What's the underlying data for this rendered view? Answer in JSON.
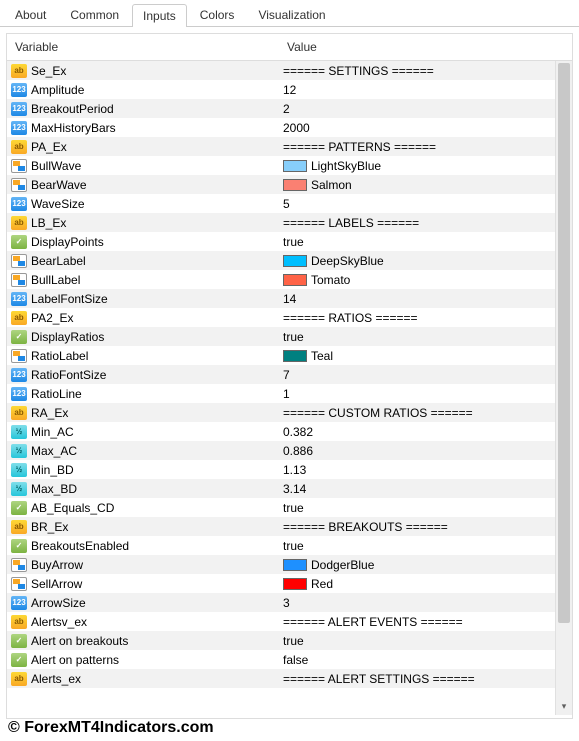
{
  "tabs": [
    {
      "label": "About",
      "active": false
    },
    {
      "label": "Common",
      "active": false
    },
    {
      "label": "Inputs",
      "active": true
    },
    {
      "label": "Colors",
      "active": false
    },
    {
      "label": "Visualization",
      "active": false
    }
  ],
  "headers": {
    "variable": "Variable",
    "value": "Value"
  },
  "rows": [
    {
      "icon": "str",
      "name": "Se_Ex",
      "valType": "text",
      "value": "====== SETTINGS ======"
    },
    {
      "icon": "int",
      "name": "Amplitude",
      "valType": "text",
      "value": "12"
    },
    {
      "icon": "int",
      "name": "BreakoutPeriod",
      "valType": "text",
      "value": "2"
    },
    {
      "icon": "int",
      "name": "MaxHistoryBars",
      "valType": "text",
      "value": "2000"
    },
    {
      "icon": "str",
      "name": "PA_Ex",
      "valType": "text",
      "value": "====== PATTERNS  ======"
    },
    {
      "icon": "color",
      "name": "BullWave",
      "valType": "color",
      "value": "LightSkyBlue",
      "swatch": "#87CEFA"
    },
    {
      "icon": "color",
      "name": "BearWave",
      "valType": "color",
      "value": "Salmon",
      "swatch": "#FA8072"
    },
    {
      "icon": "int",
      "name": "WaveSize",
      "valType": "text",
      "value": "5"
    },
    {
      "icon": "str",
      "name": "LB_Ex",
      "valType": "text",
      "value": "====== LABELS ======"
    },
    {
      "icon": "bool",
      "name": "DisplayPoints",
      "valType": "text",
      "value": "true"
    },
    {
      "icon": "color",
      "name": "BearLabel",
      "valType": "color",
      "value": "DeepSkyBlue",
      "swatch": "#00BFFF"
    },
    {
      "icon": "color",
      "name": "BullLabel",
      "valType": "color",
      "value": "Tomato",
      "swatch": "#FF6347"
    },
    {
      "icon": "int",
      "name": "LabelFontSize",
      "valType": "text",
      "value": "14"
    },
    {
      "icon": "str",
      "name": "PA2_Ex",
      "valType": "text",
      "value": "====== RATIOS ======"
    },
    {
      "icon": "bool",
      "name": "DisplayRatios",
      "valType": "text",
      "value": "true"
    },
    {
      "icon": "color",
      "name": "RatioLabel",
      "valType": "color",
      "value": "Teal",
      "swatch": "#008080"
    },
    {
      "icon": "int",
      "name": "RatioFontSize",
      "valType": "text",
      "value": "7"
    },
    {
      "icon": "int",
      "name": "RatioLine",
      "valType": "text",
      "value": "1"
    },
    {
      "icon": "str",
      "name": "RA_Ex",
      "valType": "text",
      "value": "====== CUSTOM RATIOS ======"
    },
    {
      "icon": "dbl",
      "name": "Min_AC",
      "valType": "text",
      "value": "0.382"
    },
    {
      "icon": "dbl",
      "name": "Max_AC",
      "valType": "text",
      "value": "0.886"
    },
    {
      "icon": "dbl",
      "name": "Min_BD",
      "valType": "text",
      "value": "1.13"
    },
    {
      "icon": "dbl",
      "name": "Max_BD",
      "valType": "text",
      "value": "3.14"
    },
    {
      "icon": "bool",
      "name": "AB_Equals_CD",
      "valType": "text",
      "value": "true"
    },
    {
      "icon": "str",
      "name": "BR_Ex",
      "valType": "text",
      "value": "====== BREAKOUTS ======"
    },
    {
      "icon": "bool",
      "name": "BreakoutsEnabled",
      "valType": "text",
      "value": "true"
    },
    {
      "icon": "color",
      "name": "BuyArrow",
      "valType": "color",
      "value": "DodgerBlue",
      "swatch": "#1E90FF"
    },
    {
      "icon": "color",
      "name": "SellArrow",
      "valType": "color",
      "value": "Red",
      "swatch": "#FF0000"
    },
    {
      "icon": "int",
      "name": "ArrowSize",
      "valType": "text",
      "value": "3"
    },
    {
      "icon": "str",
      "name": "Alertsv_ex",
      "valType": "text",
      "value": "====== ALERT EVENTS ======"
    },
    {
      "icon": "bool",
      "name": "Alert on breakouts",
      "valType": "text",
      "value": "true"
    },
    {
      "icon": "bool",
      "name": "Alert on patterns",
      "valType": "text",
      "value": "false"
    },
    {
      "icon": "str",
      "name": "Alerts_ex",
      "valType": "text",
      "value": "====== ALERT SETTINGS ======"
    }
  ],
  "iconText": {
    "str": "ab",
    "int": "123",
    "dbl": "½",
    "bool": "✓",
    "color": ""
  },
  "watermark": "© ForexMT4Indicators.com"
}
